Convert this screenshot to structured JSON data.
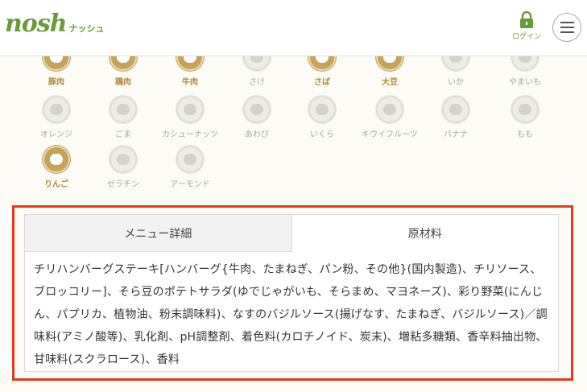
{
  "header": {
    "logo_main": "nosh",
    "logo_sub": "ナッシュ",
    "login_label": "ログイン"
  },
  "allergens": [
    {
      "label": "豚肉",
      "active": true
    },
    {
      "label": "鶏肉",
      "active": true
    },
    {
      "label": "牛肉",
      "active": true
    },
    {
      "label": "さけ",
      "active": false
    },
    {
      "label": "さば",
      "active": true
    },
    {
      "label": "大豆",
      "active": true
    },
    {
      "label": "いか",
      "active": false
    },
    {
      "label": "やまいも",
      "active": false
    },
    {
      "label": "オレンジ",
      "active": false
    },
    {
      "label": "ごま",
      "active": false
    },
    {
      "label": "カシューナッツ",
      "active": false
    },
    {
      "label": "あわび",
      "active": false
    },
    {
      "label": "いくら",
      "active": false
    },
    {
      "label": "キウイフルーツ",
      "active": false
    },
    {
      "label": "バナナ",
      "active": false
    },
    {
      "label": "もも",
      "active": false
    },
    {
      "label": "りんご",
      "active": true
    },
    {
      "label": "ゼラチン",
      "active": false
    },
    {
      "label": "アーモンド",
      "active": false
    }
  ],
  "tabs": {
    "menu_detail": "メニュー詳細",
    "ingredients": "原材料"
  },
  "ingredients_text": "チリハンバーグステーキ[ハンバーグ{牛肉、たまねぎ、パン粉、その他}(国内製造)、チリソース、ブロッコリー]、そら豆のポテトサラダ(ゆでじゃがいも、そらまめ、マヨネーズ)、彩り野菜(にんじん、パプリカ、植物油、粉末調味料)、なすのバジルソース(揚げなす、たまねぎ、バジルソース)／調味料(アミノ酸等)、乳化剤、pH調整剤、着色料(カロチノイド、炭末)、増粘多糖類、香辛料抽出物、甘味料(スクラロース)、香料",
  "colors": {
    "brand_green": "#6b9a3a",
    "allergen_gold": "#c7a35a",
    "highlight_red": "#e8381f"
  }
}
